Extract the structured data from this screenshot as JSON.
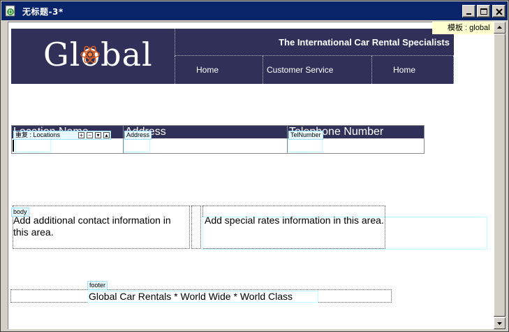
{
  "window": {
    "title": "无标题-3*"
  },
  "template_tag": "模板 : global",
  "header": {
    "logo_text": "Global",
    "tagline": "The International Car Rental Specialists",
    "nav": [
      "Home",
      "Customer Service",
      "Home"
    ]
  },
  "table": {
    "repeat_tag": "重复 : Locations",
    "columns": [
      "Location Name",
      "Address",
      "Telephone Number"
    ],
    "address_tag": "Address",
    "tel_tag": "TelNumber"
  },
  "body": {
    "tag": "body",
    "left_text": "Add additional contact information in this area.",
    "right_text": "Add special rates information in this area."
  },
  "footer": {
    "tag": "footer",
    "text": "Global Car Rentals * World Wide * World Class"
  },
  "colors": {
    "titlebar": "#0a246a",
    "header_bg": "#303058",
    "editable_border": "#bbffff"
  }
}
